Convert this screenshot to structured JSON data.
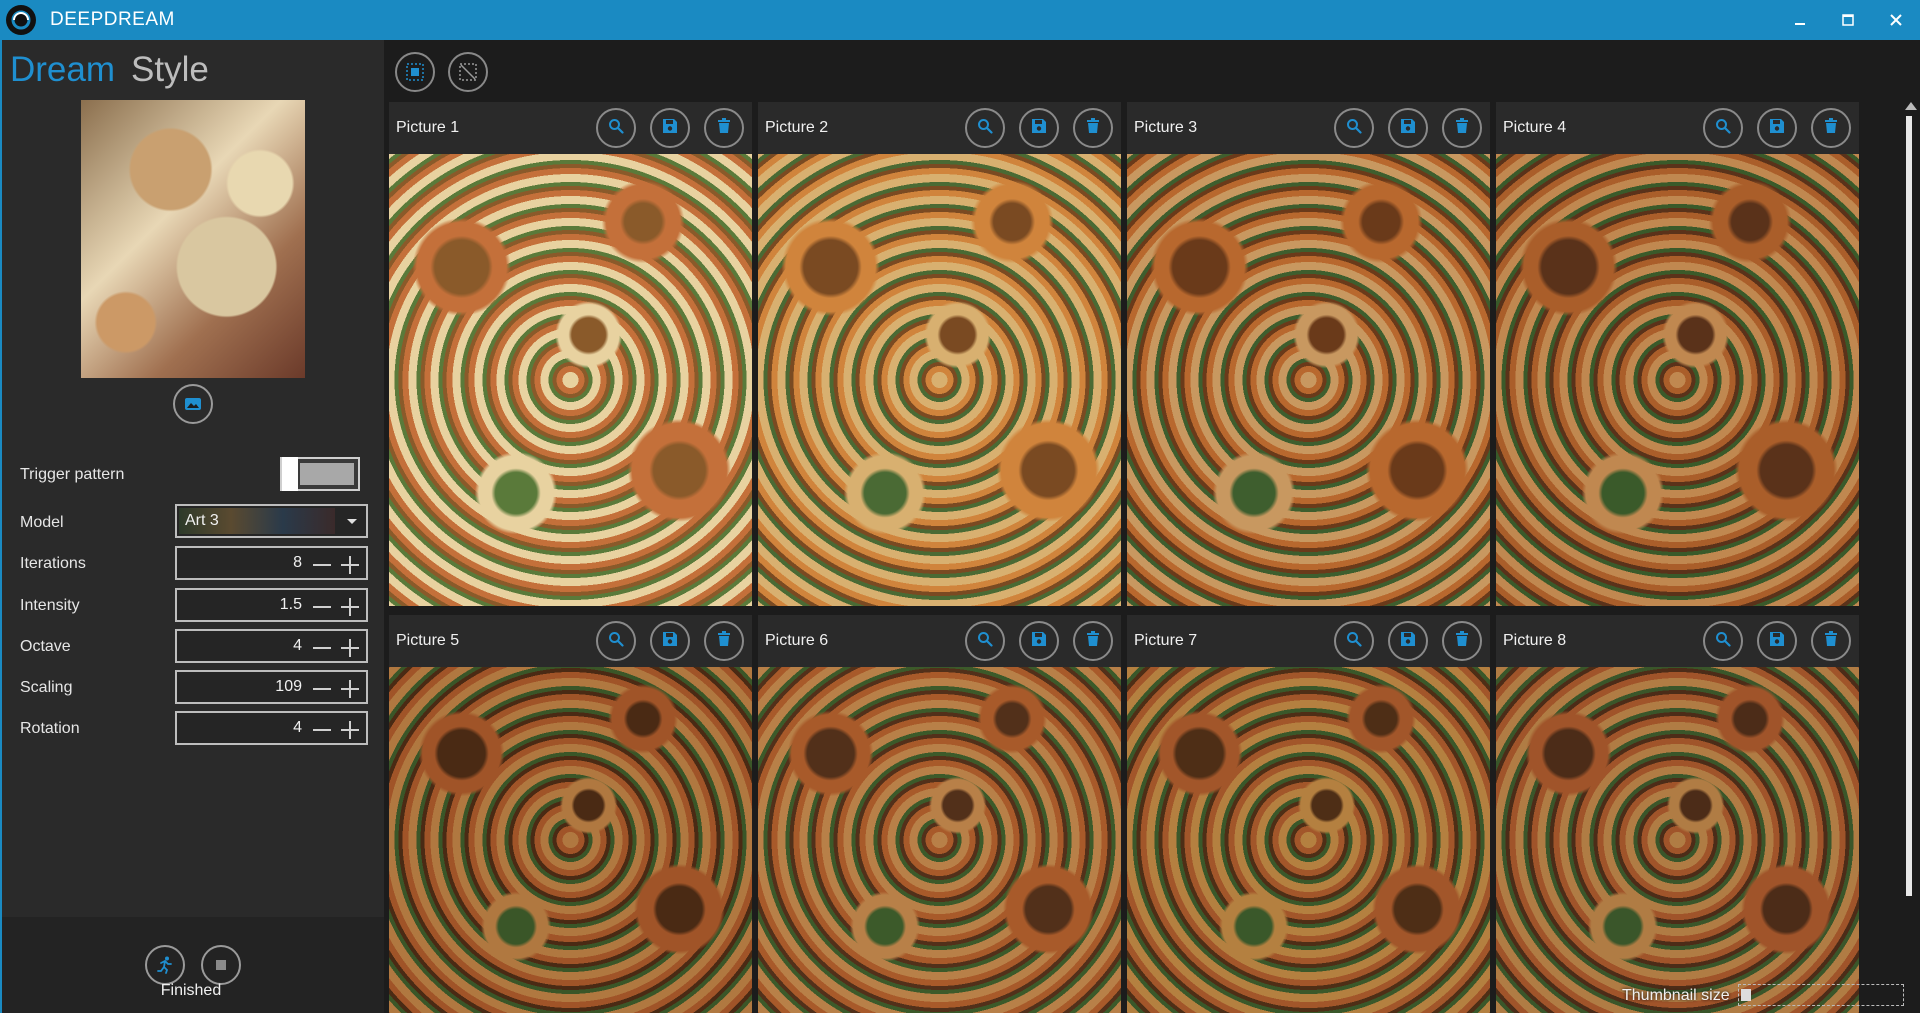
{
  "window": {
    "title": "DEEPDREAM",
    "logo_icon": "deepdream-logo",
    "controls": [
      "minimize-icon",
      "maximize-icon",
      "close-icon"
    ]
  },
  "tabs": {
    "dream": "Dream",
    "style": "Style"
  },
  "sidebar": {
    "source_image_icon": "image-icon",
    "trigger_pattern_label": "Trigger pattern",
    "trigger_pattern_on": true,
    "model": {
      "label": "Model",
      "value": "Art 3"
    },
    "iterations": {
      "label": "Iterations",
      "value": "8"
    },
    "intensity": {
      "label": "Intensity",
      "value": "1.5"
    },
    "octave": {
      "label": "Octave",
      "value": "4"
    },
    "scaling": {
      "label": "Scaling",
      "value": "109"
    },
    "rotation": {
      "label": "Rotation",
      "value": "4"
    },
    "status": "Finished"
  },
  "toolbar": {
    "select_all_icon": "select-all-icon",
    "deselect_icon": "deselect-icon"
  },
  "pictures": [
    {
      "title": "Picture 1"
    },
    {
      "title": "Picture 2"
    },
    {
      "title": "Picture 3"
    },
    {
      "title": "Picture 4"
    },
    {
      "title": "Picture 5"
    },
    {
      "title": "Picture 6"
    },
    {
      "title": "Picture 7"
    },
    {
      "title": "Picture 8"
    }
  ],
  "footer": {
    "thumbnail_size_label": "Thumbnail size"
  },
  "colors": {
    "accent": "#1a8ac2",
    "tab_active": "#1f8fd0",
    "panel": "#2a2a2a",
    "background": "#1c1c1c"
  }
}
